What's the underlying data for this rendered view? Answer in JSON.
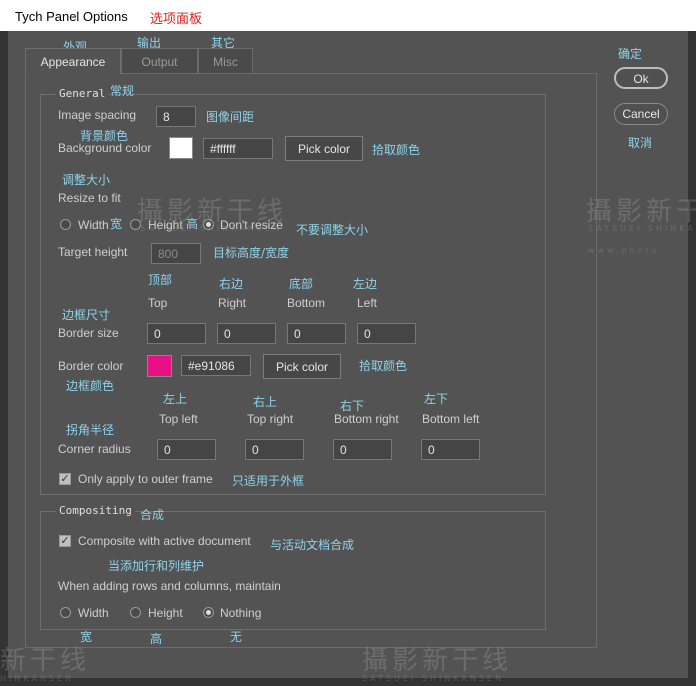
{
  "window": {
    "title": "Tych Panel Options",
    "title_cn": "选项面板"
  },
  "tabs": [
    {
      "label": "Appearance",
      "cn": "外观"
    },
    {
      "label": "Output",
      "cn": "输出"
    },
    {
      "label": "Misc",
      "cn": "其它"
    }
  ],
  "dialog_buttons": {
    "ok_label": "Ok",
    "ok_cn": "确定",
    "cancel_label": "Cancel",
    "cancel_cn": "取消"
  },
  "general": {
    "legend": "General",
    "legend_cn": "常规",
    "image_spacing_label": "Image spacing",
    "image_spacing_value": "8",
    "image_spacing_cn": "图像间距",
    "background_color_label": "Background color",
    "background_color_cn": "背景颜色",
    "background_color_hex": "#ffffff",
    "background_pick_label": "Pick color",
    "background_pick_cn": "拾取颜色",
    "resize_cn": "调整大小",
    "resize_label": "Resize to fit",
    "resize_width": "Width",
    "resize_width_cn": "宽",
    "resize_height": "Height",
    "resize_height_cn": "高",
    "resize_dont": "Don't resize",
    "resize_dont_cn": "不要调整大小",
    "target_height_label": "Target height",
    "target_height_value": "800",
    "target_height_cn": "目标高度/宽度",
    "sides": [
      {
        "label": "Top",
        "cn": "顶部"
      },
      {
        "label": "Right",
        "cn": "右边"
      },
      {
        "label": "Bottom",
        "cn": "底部"
      },
      {
        "label": "Left",
        "cn": "左边"
      }
    ],
    "border_size_cn": "边框尺寸",
    "border_size_label": "Border size",
    "border_size_values": [
      "0",
      "0",
      "0",
      "0"
    ],
    "border_color_label": "Border color",
    "border_color_cn": "边框颜色",
    "border_color_hex": "#e91086",
    "border_pick_label": "Pick color",
    "border_pick_cn": "拾取颜色",
    "corners": [
      {
        "label": "Top left",
        "cn": "左上"
      },
      {
        "label": "Top right",
        "cn": "右上"
      },
      {
        "label": "Bottom right",
        "cn": "右下"
      },
      {
        "label": "Bottom left",
        "cn": "左下"
      }
    ],
    "corner_radius_cn": "拐角半径",
    "corner_radius_label": "Corner radius",
    "corner_radius_values": [
      "0",
      "0",
      "0",
      "0"
    ],
    "outer_frame_label": "Only apply to outer frame",
    "outer_frame_cn": "只适用于外框"
  },
  "compositing": {
    "legend": "Compositing",
    "legend_cn": "合成",
    "composite_label": "Composite with active document",
    "composite_cn": "与活动文档合成",
    "maintain_cn": "当添加行和列维护",
    "maintain_label": "When adding rows and columns, maintain",
    "opt_width": "Width",
    "opt_width_cn": "宽",
    "opt_height": "Height",
    "opt_height_cn": "高",
    "opt_nothing": "Nothing",
    "opt_nothing_cn": "无"
  },
  "watermark": {
    "text": "攝影新干线",
    "sub": "SATSUEI SHINKANSEN",
    "sub2": "www.photo",
    "text_partial": "新干线",
    "sub_partial": "HINKANSEN"
  },
  "colors": {
    "bg": "#535353",
    "accent_cn": "#8fd3ea",
    "title_cn": "#e02020",
    "border_color": "#e91086"
  }
}
